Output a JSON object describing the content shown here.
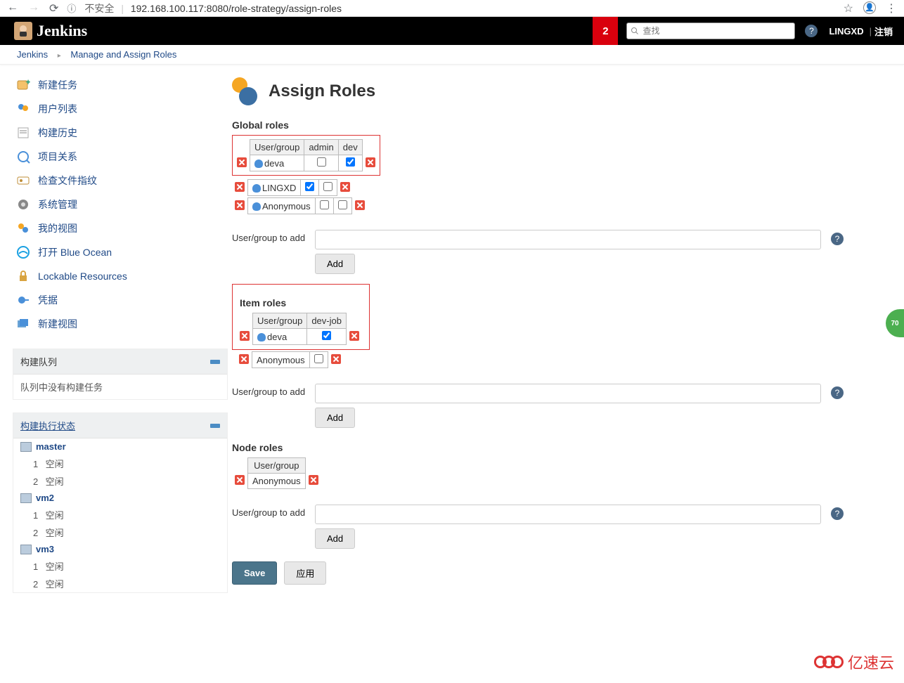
{
  "browser": {
    "url_insecure": "不安全",
    "url": "192.168.100.117:8080/role-strategy/assign-roles"
  },
  "header": {
    "brand": "Jenkins",
    "badge": "2",
    "search_placeholder": "查找",
    "user": "LINGXD",
    "logout": "注销"
  },
  "breadcrumbs": {
    "items": [
      "Jenkins",
      "Manage and Assign Roles"
    ]
  },
  "sidebar": {
    "tasks": [
      {
        "label": "新建任务",
        "icon": "new-item"
      },
      {
        "label": "用户列表",
        "icon": "users"
      },
      {
        "label": "构建历史",
        "icon": "history"
      },
      {
        "label": "项目关系",
        "icon": "relations"
      },
      {
        "label": "检查文件指纹",
        "icon": "fingerprint"
      },
      {
        "label": "系统管理",
        "icon": "manage"
      },
      {
        "label": "我的视图",
        "icon": "my-views"
      },
      {
        "label": "打开 Blue Ocean",
        "icon": "blue-ocean"
      },
      {
        "label": "Lockable Resources",
        "icon": "lock"
      },
      {
        "label": "凭据",
        "icon": "credentials"
      },
      {
        "label": "新建视图",
        "icon": "new-view"
      }
    ],
    "queue": {
      "title": "构建队列",
      "empty": "队列中没有构建任务"
    },
    "executors": {
      "title": "构建执行状态",
      "nodes": [
        {
          "name": "master",
          "slots": [
            {
              "n": "1",
              "s": "空闲"
            },
            {
              "n": "2",
              "s": "空闲"
            }
          ]
        },
        {
          "name": "vm2",
          "slots": [
            {
              "n": "1",
              "s": "空闲"
            },
            {
              "n": "2",
              "s": "空闲"
            }
          ]
        },
        {
          "name": "vm3",
          "slots": [
            {
              "n": "1",
              "s": "空闲"
            },
            {
              "n": "2",
              "s": "空闲"
            }
          ]
        }
      ]
    }
  },
  "main": {
    "title": "Assign Roles",
    "global": {
      "title": "Global roles",
      "header_user": "User/group",
      "cols": [
        "admin",
        "dev"
      ],
      "rows": [
        {
          "name": "deva",
          "checks": [
            false,
            true
          ],
          "highlighted": true
        },
        {
          "name": "LINGXD",
          "checks": [
            true,
            false
          ],
          "highlighted": false
        },
        {
          "name": "Anonymous",
          "checks": [
            false,
            false
          ],
          "highlighted": false
        }
      ]
    },
    "item": {
      "title": "Item roles",
      "header_user": "User/group",
      "cols": [
        "dev-job"
      ],
      "rows": [
        {
          "name": "deva",
          "checks": [
            true
          ],
          "highlighted": true
        },
        {
          "name": "Anonymous",
          "checks": [
            false
          ],
          "highlighted": false
        }
      ]
    },
    "node": {
      "title": "Node roles",
      "header_user": "User/group",
      "rows": [
        {
          "name": "Anonymous"
        }
      ]
    },
    "add_label": "User/group to add",
    "add_button": "Add",
    "save": "Save",
    "apply": "应用"
  },
  "floater": "70",
  "watermark": "亿速云"
}
